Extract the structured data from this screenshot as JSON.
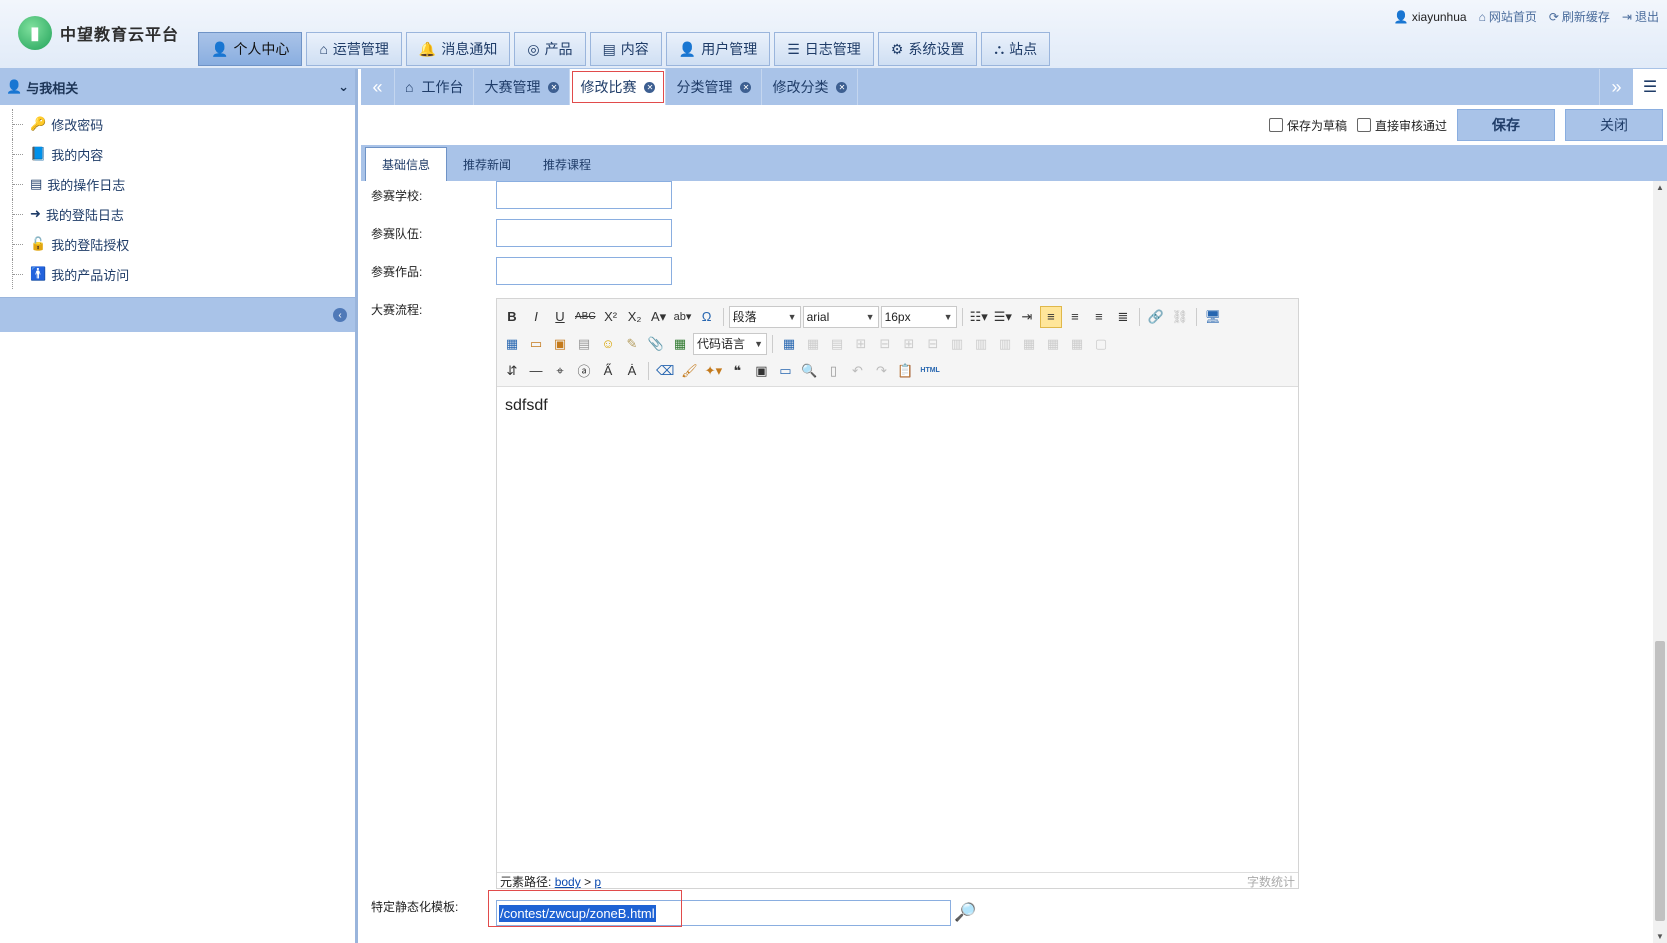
{
  "brand": {
    "name": "中望教育云平台"
  },
  "nav": {
    "items": [
      {
        "label": "个人中心",
        "icon": "user-icon"
      },
      {
        "label": "运营管理",
        "icon": "home-icon"
      },
      {
        "label": "消息通知",
        "icon": "bell-icon"
      },
      {
        "label": "产品",
        "icon": "globe-icon"
      },
      {
        "label": "内容",
        "icon": "file-icon"
      },
      {
        "label": "用户管理",
        "icon": "user-icon"
      },
      {
        "label": "日志管理",
        "icon": "list-icon"
      },
      {
        "label": "系统设置",
        "icon": "gear-icon"
      },
      {
        "label": "站点",
        "icon": "sitemap-icon"
      }
    ]
  },
  "topright": {
    "user": "xiayunhua",
    "home": "网站首页",
    "refresh": "刷新缓存",
    "logout": "退出"
  },
  "sidebar": {
    "title": "与我相关",
    "items": [
      {
        "label": "修改密码"
      },
      {
        "label": "我的内容"
      },
      {
        "label": "我的操作日志"
      },
      {
        "label": "我的登陆日志"
      },
      {
        "label": "我的登陆授权"
      },
      {
        "label": "我的产品访问"
      }
    ]
  },
  "tabs": {
    "items": [
      {
        "label": "工作台"
      },
      {
        "label": "大赛管理"
      },
      {
        "label": "修改比赛"
      },
      {
        "label": "分类管理"
      },
      {
        "label": "修改分类"
      }
    ]
  },
  "actions": {
    "draft": "保存为草稿",
    "direct_approve": "直接审核通过",
    "save": "保存",
    "close": "关闭"
  },
  "formtabs": {
    "items": [
      {
        "label": "基础信息"
      },
      {
        "label": "推荐新闻"
      },
      {
        "label": "推荐课程"
      }
    ]
  },
  "form": {
    "school_label": "参赛学校:",
    "team_label": "参赛队伍:",
    "work_label": "参赛作品:",
    "process_label": "大赛流程:",
    "template_label": "特定静态化模板:",
    "template_value": "/contest/zwcup/zoneB.html"
  },
  "editor": {
    "paragraph": "段落",
    "font": "arial",
    "size": "16px",
    "code_lang": "代码语言",
    "content": "sdfsdf",
    "path_label": "元素路径:",
    "path_body": "body",
    "path_sep": ">",
    "path_p": "p",
    "wordcount": "字数统计",
    "html_btn": "HTML"
  }
}
